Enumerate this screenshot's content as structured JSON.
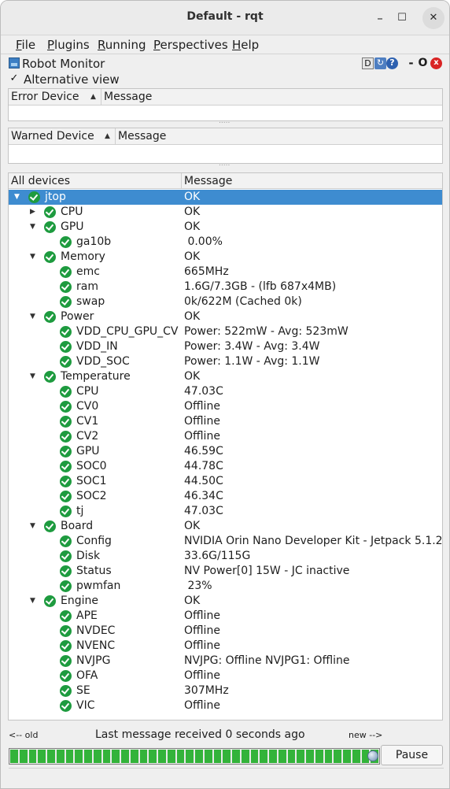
{
  "window": {
    "title": "Default - rqt"
  },
  "menu": {
    "items": [
      {
        "u": "F",
        "rest": "ile"
      },
      {
        "u": "P",
        "rest": "lugins"
      },
      {
        "u": "R",
        "rest": "unning"
      },
      {
        "u": "P",
        "rest": "erspectives",
        "pre": ""
      },
      {
        "u": "H",
        "rest": "elp"
      }
    ]
  },
  "plugin": {
    "title": "Robot Monitor",
    "d_label": "D",
    "help_label": "?",
    "dash_label": "-",
    "o_label": "O",
    "close_label": "x",
    "alt_view_label": "Alternative view",
    "alt_view_checked": "✓"
  },
  "error_table": {
    "col1": "Error Device",
    "col2": "Message"
  },
  "warn_table": {
    "col1": "Warned Device",
    "col2": "Message"
  },
  "tree": {
    "col1": "All devices",
    "col2": "Message",
    "rows": [
      {
        "name": "jtop",
        "msg": "OK",
        "level": 0,
        "arrow": "▼",
        "selected": true
      },
      {
        "name": "CPU",
        "msg": "OK",
        "level": 1,
        "arrow": "▶"
      },
      {
        "name": "GPU",
        "msg": "OK",
        "level": 1,
        "arrow": "▼"
      },
      {
        "name": "ga10b",
        "msg": " 0.00%",
        "level": 2
      },
      {
        "name": "Memory",
        "msg": "OK",
        "level": 1,
        "arrow": "▼"
      },
      {
        "name": "emc",
        "msg": "665MHz",
        "level": 2
      },
      {
        "name": "ram",
        "msg": "1.6G/7.3GB - (lfb 687x4MB)",
        "level": 2
      },
      {
        "name": "swap",
        "msg": "0k/622M (Cached 0k)",
        "level": 2
      },
      {
        "name": "Power",
        "msg": "OK",
        "level": 1,
        "arrow": "▼"
      },
      {
        "name": "VDD_CPU_GPU_CV",
        "msg": "Power: 522mW - Avg: 523mW",
        "level": 2
      },
      {
        "name": "VDD_IN",
        "msg": "Power: 3.4W - Avg: 3.4W",
        "level": 2
      },
      {
        "name": "VDD_SOC",
        "msg": "Power: 1.1W - Avg: 1.1W",
        "level": 2
      },
      {
        "name": "Temperature",
        "msg": "OK",
        "level": 1,
        "arrow": "▼"
      },
      {
        "name": "CPU",
        "msg": "47.03C",
        "level": 2
      },
      {
        "name": "CV0",
        "msg": "Offline",
        "level": 2
      },
      {
        "name": "CV1",
        "msg": "Offline",
        "level": 2
      },
      {
        "name": "CV2",
        "msg": "Offline",
        "level": 2
      },
      {
        "name": "GPU",
        "msg": "46.59C",
        "level": 2
      },
      {
        "name": "SOC0",
        "msg": "44.78C",
        "level": 2
      },
      {
        "name": "SOC1",
        "msg": "44.50C",
        "level": 2
      },
      {
        "name": "SOC2",
        "msg": "46.34C",
        "level": 2
      },
      {
        "name": "tj",
        "msg": "47.03C",
        "level": 2
      },
      {
        "name": "Board",
        "msg": "OK",
        "level": 1,
        "arrow": "▼"
      },
      {
        "name": "Config",
        "msg": "NVIDIA Orin Nano Developer Kit - Jetpack 5.1.2",
        "level": 2
      },
      {
        "name": "Disk",
        "msg": "33.6G/115G",
        "level": 2
      },
      {
        "name": "Status",
        "msg": "NV Power[0] 15W - JC inactive",
        "level": 2
      },
      {
        "name": "pwmfan",
        "msg": " 23%",
        "level": 2
      },
      {
        "name": "Engine",
        "msg": "OK",
        "level": 1,
        "arrow": "▼"
      },
      {
        "name": "APE",
        "msg": "Offline",
        "level": 2
      },
      {
        "name": "NVDEC",
        "msg": "Offline",
        "level": 2
      },
      {
        "name": "NVENC",
        "msg": "Offline",
        "level": 2
      },
      {
        "name": "NVJPG",
        "msg": "NVJPG: Offline NVJPG1: Offline",
        "level": 2
      },
      {
        "name": "OFA",
        "msg": "Offline",
        "level": 2
      },
      {
        "name": "SE",
        "msg": "307MHz",
        "level": 2
      },
      {
        "name": "VIC",
        "msg": "Offline",
        "level": 2
      }
    ]
  },
  "status": {
    "old_label": "<-- old",
    "message": "Last message received 0 seconds ago",
    "new_label": "new -->",
    "pause_label": "Pause"
  },
  "colors": {
    "ok": "#1e9b3f",
    "selection": "#3e8cd0",
    "timeline": "#33b33a"
  }
}
